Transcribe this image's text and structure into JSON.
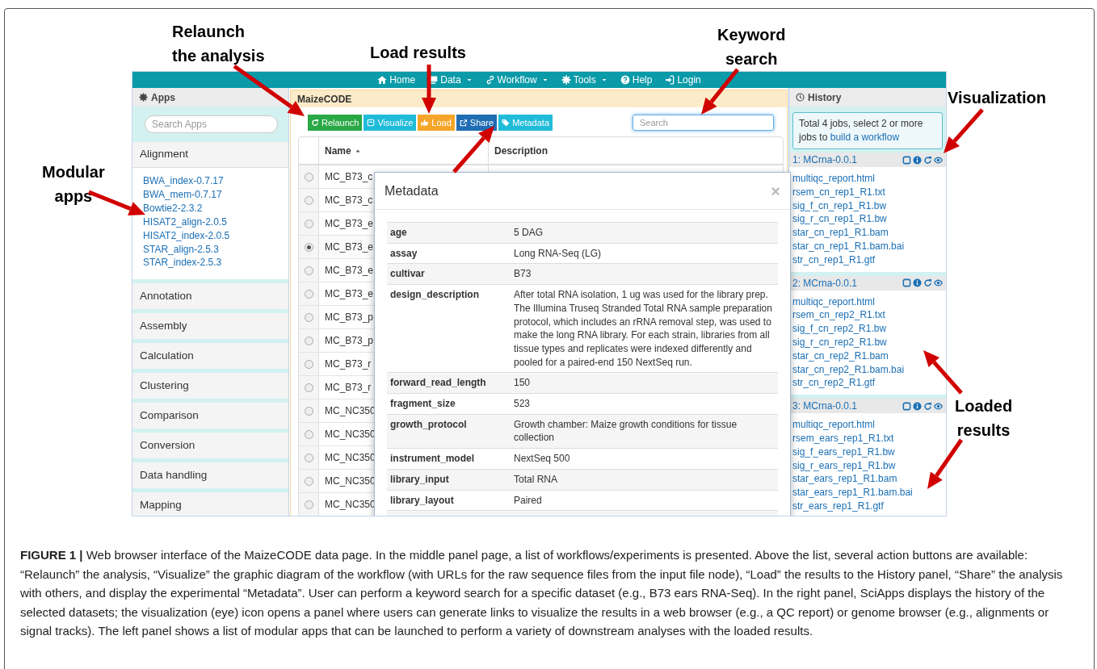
{
  "annotations": [
    {
      "lines": [
        "Relaunch",
        "the analysis"
      ]
    },
    {
      "lines": [
        "Load results"
      ]
    },
    {
      "lines": [
        "Keyword",
        "search"
      ]
    },
    {
      "lines": [
        "Visualization"
      ]
    },
    {
      "lines": [
        "Modular",
        "apps"
      ]
    },
    {
      "lines": [
        "Loaded",
        "results"
      ]
    }
  ],
  "navbar": {
    "items": [
      {
        "label": "Home",
        "dropdown": false
      },
      {
        "label": "Data",
        "dropdown": true
      },
      {
        "label": "Workflow",
        "dropdown": true
      },
      {
        "label": "Tools",
        "dropdown": true
      },
      {
        "label": "Help",
        "dropdown": false
      },
      {
        "label": "Login",
        "dropdown": false
      }
    ]
  },
  "apps_panel": {
    "title": "Apps",
    "search_placeholder": "Search Apps",
    "categories": [
      {
        "label": "Alignment",
        "expanded": true,
        "apps": [
          "BWA_index-0.7.17",
          "BWA_mem-0.7.17",
          "Bowtie2-2.3.2",
          "HISAT2_align-2.0.5",
          "HISAT2_index-2.0.5",
          "STAR_align-2.5.3",
          "STAR_index-2.5.3"
        ]
      },
      {
        "label": "Annotation",
        "expanded": false
      },
      {
        "label": "Assembly",
        "expanded": false
      },
      {
        "label": "Calculation",
        "expanded": false
      },
      {
        "label": "Clustering",
        "expanded": false
      },
      {
        "label": "Comparison",
        "expanded": false
      },
      {
        "label": "Conversion",
        "expanded": false
      },
      {
        "label": "Data handling",
        "expanded": false
      },
      {
        "label": "Mapping",
        "expanded": false
      }
    ]
  },
  "main_panel": {
    "title": "MaizeCODE",
    "buttons": [
      {
        "label": "Relaunch",
        "color": "#2aa845"
      },
      {
        "label": "Visualize",
        "color": "#1fbbd9"
      },
      {
        "label": "Load",
        "color": "#f5a52a"
      },
      {
        "label": "Share",
        "color": "#1f6db3"
      },
      {
        "label": "Metadata",
        "color": "#1fbbd9"
      }
    ],
    "search_placeholder": "Search",
    "table": {
      "columns": [
        {
          "label": "Name",
          "sorted": true
        },
        {
          "label": "Description",
          "sorted": false
        }
      ],
      "rows": [
        {
          "name": "MC_B73_c",
          "selected": false
        },
        {
          "name": "MC_B73_c",
          "selected": false
        },
        {
          "name": "MC_B73_e",
          "selected": false
        },
        {
          "name": "MC_B73_e",
          "selected": true
        },
        {
          "name": "MC_B73_e",
          "selected": false
        },
        {
          "name": "MC_B73_e",
          "selected": false
        },
        {
          "name": "MC_B73_p",
          "selected": false
        },
        {
          "name": "MC_B73_p",
          "selected": false
        },
        {
          "name": "MC_B73_r",
          "selected": false
        },
        {
          "name": "MC_B73_r",
          "selected": false
        },
        {
          "name": "MC_NC350",
          "selected": false
        },
        {
          "name": "MC_NC350",
          "selected": false
        },
        {
          "name": "MC_NC350",
          "selected": false
        },
        {
          "name": "MC_NC350",
          "selected": false
        },
        {
          "name": "MC_NC350",
          "selected": false
        }
      ]
    }
  },
  "metadata_dialog": {
    "title": "Metadata",
    "close": "×",
    "rows": [
      {
        "key": "age",
        "value": "5 DAG"
      },
      {
        "key": "assay",
        "value": "Long RNA-Seq (LG)"
      },
      {
        "key": "cultivar",
        "value": "B73"
      },
      {
        "key": "design_description",
        "value": "After total RNA isolation, 1 ug was used for the library prep. The Illumina Truseq Stranded Total RNA sample preparation protocol, which includes an rRNA removal step, was used to make the long RNA library. For each strain, libraries from all tissue types and replicates were indexed differently and pooled for a paired-end 150 NextSeq run."
      },
      {
        "key": "forward_read_length",
        "value": "150"
      },
      {
        "key": "fragment_size",
        "value": "523"
      },
      {
        "key": "growth_protocol",
        "value": "Growth chamber: Maize growth conditions for tissue collection"
      },
      {
        "key": "instrument_model",
        "value": "NextSeq 500"
      },
      {
        "key": "library_input",
        "value": "Total RNA"
      },
      {
        "key": "library_layout",
        "value": "Paired"
      }
    ]
  },
  "history_panel": {
    "title": "History",
    "info": "Total 4 jobs, select 2 or more jobs to",
    "info_link": "build a workflow",
    "jobs": [
      {
        "title": "1: MCrna-0.0.1",
        "files": [
          "multiqc_report.html",
          "rsem_cn_rep1_R1.txt",
          "sig_f_cn_rep1_R1.bw",
          "sig_r_cn_rep1_R1.bw",
          "star_cn_rep1_R1.bam",
          "star_cn_rep1_R1.bam.bai",
          "str_cn_rep1_R1.gtf"
        ]
      },
      {
        "title": "2: MCrna-0.0.1",
        "files": [
          "multiqc_report.html",
          "rsem_cn_rep2_R1.txt",
          "sig_f_cn_rep2_R1.bw",
          "sig_r_cn_rep2_R1.bw",
          "star_cn_rep2_R1.bam",
          "star_cn_rep2_R1.bam.bai",
          "str_cn_rep2_R1.gtf"
        ]
      },
      {
        "title": "3: MCrna-0.0.1",
        "files": [
          "multiqc_report.html",
          "rsem_ears_rep1_R1.txt",
          "sig_f_ears_rep1_R1.bw",
          "sig_r_ears_rep1_R1.bw",
          "star_ears_rep1_R1.bam",
          "star_ears_rep1_R1.bam.bai",
          "str_ears_rep1_R1.gtf"
        ]
      }
    ]
  },
  "caption": "**FIGURE 1 |** Web browser interface of the MaizeCODE data page. In the middle panel page, a list of workflows/experiments is presented. Above the list, several action buttons are available: “Relaunch” the analysis, “Visualize” the graphic diagram of the workflow (with URLs for the raw sequence files from the input file node), “Load” the results to the History panel, “Share” the analysis with others, and display the experimental “Metadata”. User can perform a keyword search for a specific dataset (e.g., B73 ears RNA-Seq). In the right panel, SciApps displays the history of the selected datasets; the visualization (eye) icon opens a panel where users can generate links to visualize the results in a web browser (e.g., a QC report) or genome browser (e.g., alignments or signal tracks). The left panel shows a list of modular apps that can be launched to perform a variety of downstream analyses with the loaded results."
}
